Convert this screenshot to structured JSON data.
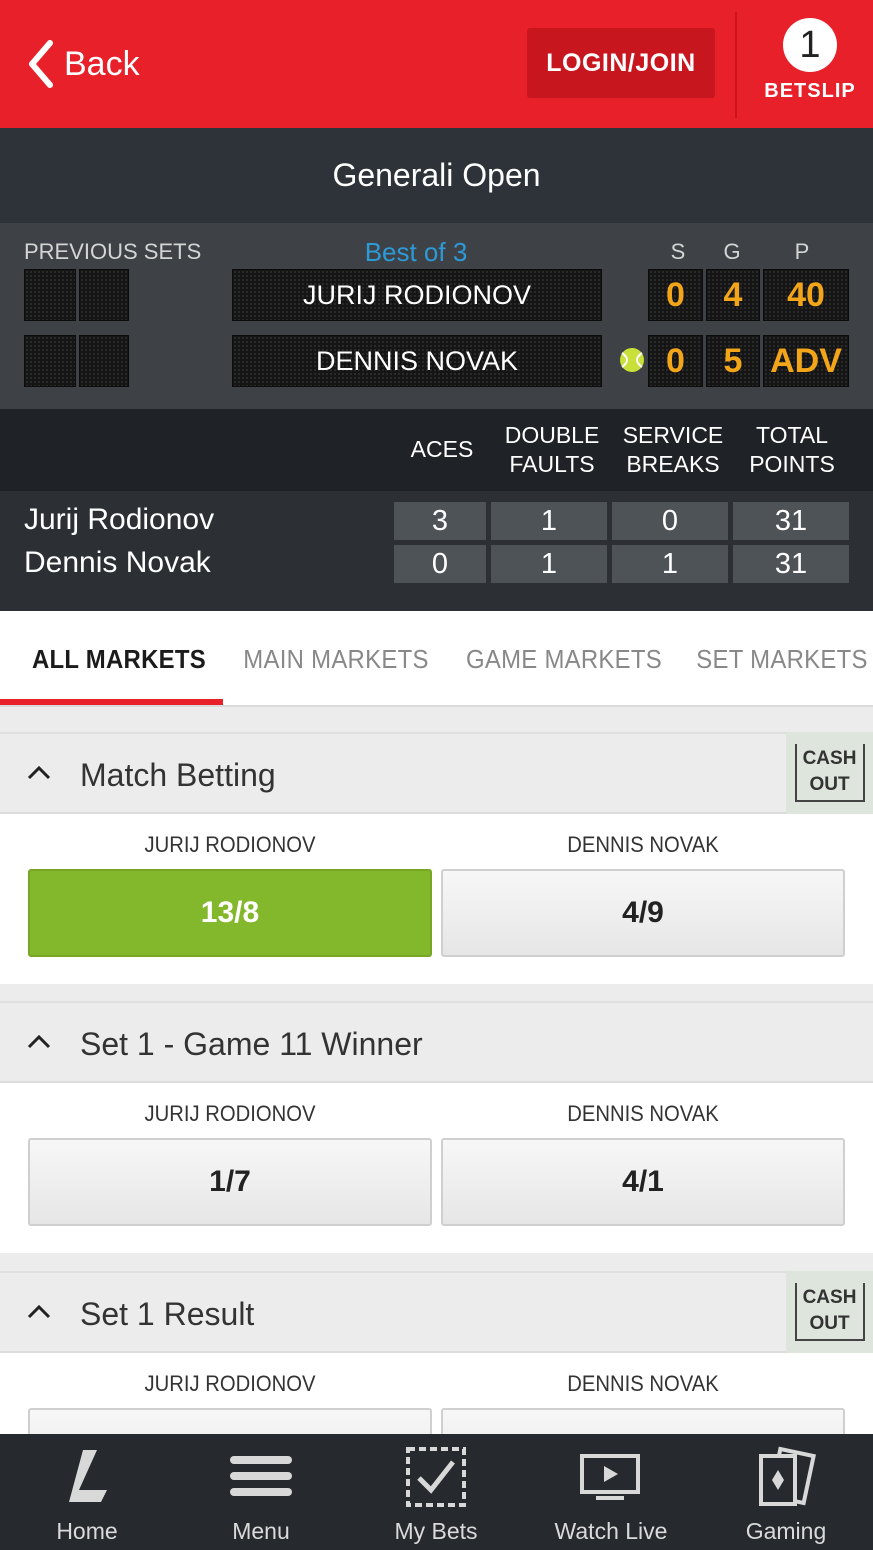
{
  "header": {
    "back_label": "Back",
    "login_label": "LOGIN/JOIN",
    "betslip_count": "1",
    "betslip_label": "BETSLIP"
  },
  "event": {
    "title": "Generali Open"
  },
  "scoreboard": {
    "previous_sets_label": "PREVIOUS SETS",
    "format_label": "Best of 3",
    "col_labels": {
      "sets": "S",
      "games": "G",
      "points": "P"
    },
    "players": [
      {
        "name": "JURIJ RODIONOV",
        "sets": "0",
        "games": "4",
        "points": "40",
        "serving": false
      },
      {
        "name": "DENNIS NOVAK",
        "sets": "0",
        "games": "5",
        "points": "ADV",
        "serving": true
      }
    ]
  },
  "stats": {
    "headers": {
      "aces": "ACES",
      "double_faults_1": "DOUBLE",
      "double_faults_2": "FAULTS",
      "service_breaks_1": "SERVICE",
      "service_breaks_2": "BREAKS",
      "total_points_1": "TOTAL",
      "total_points_2": "POINTS"
    },
    "rows": [
      {
        "name": "Jurij Rodionov",
        "aces": "3",
        "double_faults": "1",
        "service_breaks": "0",
        "total_points": "31"
      },
      {
        "name": "Dennis Novak",
        "aces": "0",
        "double_faults": "1",
        "service_breaks": "1",
        "total_points": "31"
      }
    ]
  },
  "tabs": [
    "ALL MARKETS",
    "MAIN MARKETS",
    "GAME MARKETS",
    "SET MARKETS"
  ],
  "markets": [
    {
      "title": "Match Betting",
      "cash_out_1": "CASH",
      "cash_out_2": "OUT",
      "selections": [
        {
          "name": "JURIJ RODIONOV",
          "odds": "13/8",
          "selected": true
        },
        {
          "name": "DENNIS NOVAK",
          "odds": "4/9",
          "selected": false
        }
      ]
    },
    {
      "title": "Set 1 - Game 11 Winner",
      "selections": [
        {
          "name": "JURIJ RODIONOV",
          "odds": "1/7",
          "selected": false
        },
        {
          "name": "DENNIS NOVAK",
          "odds": "4/1",
          "selected": false
        }
      ]
    },
    {
      "title": "Set 1 Result",
      "cash_out_1": "CASH",
      "cash_out_2": "OUT",
      "selections": [
        {
          "name": "JURIJ RODIONOV",
          "odds": "",
          "selected": false
        },
        {
          "name": "DENNIS NOVAK",
          "odds": "",
          "selected": false
        }
      ]
    }
  ],
  "bottom_nav": [
    {
      "label": "Home",
      "icon": "home-logo-icon"
    },
    {
      "label": "Menu",
      "icon": "hamburger-icon"
    },
    {
      "label": "My Bets",
      "icon": "my-bets-icon"
    },
    {
      "label": "Watch Live",
      "icon": "tv-icon"
    },
    {
      "label": "Gaming",
      "icon": "cards-icon"
    }
  ],
  "colors": {
    "brand_red": "#e8202a",
    "score_amber": "#f3a51a",
    "selected_green": "#84b82c",
    "link_blue": "#2d9ad8"
  }
}
